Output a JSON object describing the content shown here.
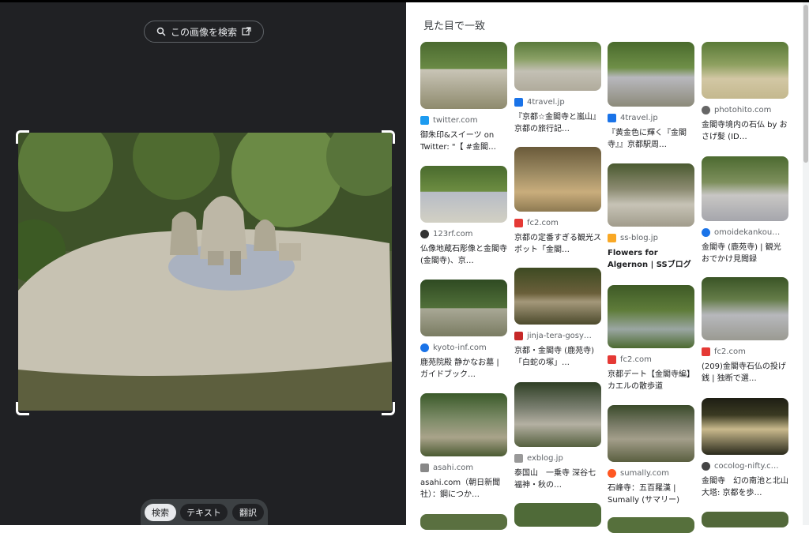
{
  "lens": {
    "search_label": "この画像を検索",
    "modes": [
      "検索",
      "テキスト",
      "翻訳"
    ],
    "active_mode": "検索"
  },
  "results": {
    "title": "見た目で一致",
    "items": [
      {
        "source": "twitter.com",
        "title": "御朱印&スイーツ on Twitter: \"【 #金閣…",
        "fav": "#1d9bf0"
      },
      {
        "source": "4travel.jp",
        "title": "『京都☆金閣寺と嵐山』京都の旅行記…",
        "fav": "#1a73e8"
      },
      {
        "source": "4travel.jp",
        "title": "『黄金色に輝く『金閣寺』』京都駅周…",
        "fav": "#1a73e8"
      },
      {
        "source": "photohito.com",
        "title": "金閣寺境内の石仏 by おさげ髪 (ID…",
        "fav": "#666666"
      },
      {
        "source": "123rf.com",
        "title": "仏像地蔵石彫像と金閣寺 (金閣寺)、京…",
        "fav": "#333333"
      },
      {
        "source": "fc2.com",
        "title": "京都の定番すぎる観光スポット「金閣…",
        "fav": "#e53935"
      },
      {
        "source": "ss-blog.jp",
        "title": "Flowers for Algernon | SSブログ",
        "fav": "#f9a825"
      },
      {
        "source": "omoidekankou…",
        "title": "金閣寺 (鹿苑寺) | 観光おでかけ見聞録",
        "fav": "#1a73e8"
      },
      {
        "source": "kyoto-inf.com",
        "title": "鹿苑院殿 静かなお墓 | ガイドブック…",
        "fav": "#1a73e8"
      },
      {
        "source": "jinja-tera-gosy…",
        "title": "京都・金閣寺 (鹿苑寺) 「白蛇の塚」…",
        "fav": "#c62828"
      },
      {
        "source": "fc2.com",
        "title": "京都デート【金閣寺編】カエルの散歩道",
        "fav": "#e53935"
      },
      {
        "source": "fc2.com",
        "title": "(209)金閣寺石仏の投げ銭 | 独断で選…",
        "fav": "#e53935"
      },
      {
        "source": "asahi.com",
        "title": "asahi.com（朝日新聞社）：鋼につか…",
        "fav": "#888888"
      },
      {
        "source": "exblog.jp",
        "title": "泰国山　一乗寺 深谷七福神・秋の…",
        "fav": "#999999"
      },
      {
        "source": "sumally.com",
        "title": "石峰寺：五百羅漢 | Sumally (サマリー)",
        "fav": "#ff5722"
      },
      {
        "source": "cocolog-nifty.c…",
        "title": "金閣寺　幻の南池と北山大塔: 京都を歩…",
        "fav": "#444444"
      }
    ]
  },
  "colors": {
    "panel_dark": "#202124",
    "accent": "#1a73e8"
  }
}
